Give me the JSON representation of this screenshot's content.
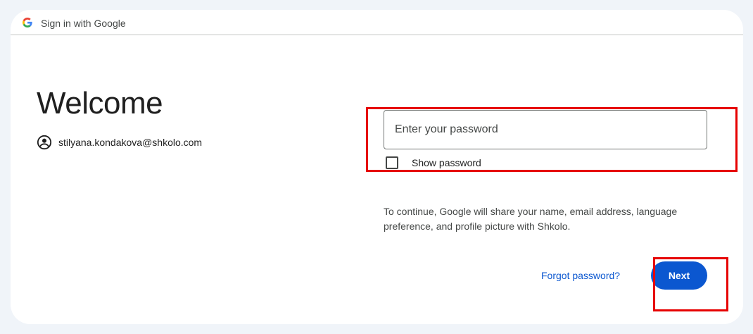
{
  "header": {
    "title": "Sign in with Google",
    "logo_icon": "google-g-icon"
  },
  "main": {
    "heading": "Welcome",
    "account_icon": "account-circle-icon",
    "account_email": "stilyana.kondakova@shkolo.com"
  },
  "form": {
    "password_placeholder": "Enter your password",
    "password_value": "",
    "show_password_label": "Show password",
    "show_password_checked": false,
    "disclosure": "To continue, Google will share your name, email address, language preference, and profile picture with Shkolo.",
    "forgot_password_label": "Forgot password?",
    "next_label": "Next"
  },
  "colors": {
    "page_background": "#f0f4f9",
    "primary": "#0b57d0",
    "highlight": "#e60000"
  }
}
